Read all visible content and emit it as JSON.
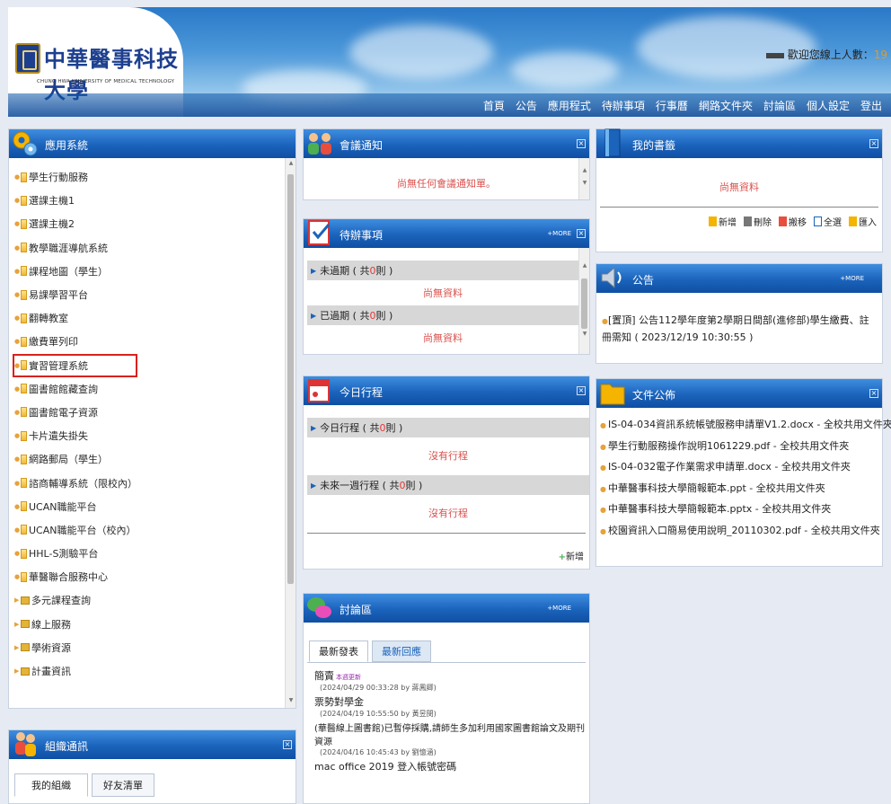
{
  "header": {
    "school_name": "中華醫事科技大學",
    "school_name_en": "CHUNG HWA UNIVERSITY OF MEDICAL TECHNOLOGY",
    "online_label": "歡迎您線上人數：",
    "online_count": "19",
    "nav": [
      "首頁",
      "公告",
      "應用程式",
      "待辦事項",
      "行事曆",
      "網路文件夾",
      "討論區",
      "個人設定",
      "登出"
    ]
  },
  "apps": {
    "title": "應用系統",
    "items": [
      {
        "label": "學生行動服務",
        "kind": "file"
      },
      {
        "label": "選課主機1",
        "kind": "file"
      },
      {
        "label": "選課主機2",
        "kind": "file"
      },
      {
        "label": "教學職涯導航系統",
        "kind": "file"
      },
      {
        "label": "課程地圖（學生）",
        "kind": "file"
      },
      {
        "label": "易課學習平台",
        "kind": "file"
      },
      {
        "label": "翻轉教室",
        "kind": "file"
      },
      {
        "label": "繳費單列印",
        "kind": "file"
      },
      {
        "label": "實習管理系統",
        "kind": "file",
        "selected": true
      },
      {
        "label": "圖書館館藏查詢",
        "kind": "file"
      },
      {
        "label": "圖書館電子資源",
        "kind": "file"
      },
      {
        "label": "卡片遺失掛失",
        "kind": "file"
      },
      {
        "label": "網路郵局（學生）",
        "kind": "file"
      },
      {
        "label": "諮商輔導系統（限校內）",
        "kind": "file"
      },
      {
        "label": "UCAN職能平台",
        "kind": "file"
      },
      {
        "label": "UCAN職能平台（校內）",
        "kind": "file"
      },
      {
        "label": "HHL-S測驗平台",
        "kind": "file"
      },
      {
        "label": "華醫聯合服務中心",
        "kind": "file"
      },
      {
        "label": "多元課程查詢",
        "kind": "folder"
      },
      {
        "label": "線上服務",
        "kind": "folder"
      },
      {
        "label": "學術資源",
        "kind": "folder"
      },
      {
        "label": "計畫資訊",
        "kind": "folder"
      }
    ]
  },
  "groups": {
    "title": "組織通訊",
    "tabs": [
      "我的組織",
      "好友清單"
    ]
  },
  "meeting": {
    "title": "會議通知",
    "empty": "尚無任何會議通知單。"
  },
  "todo": {
    "title": "待辦事項",
    "more": "+MORE",
    "sections": [
      {
        "prefix": "未過期 ( 共 ",
        "count": "0",
        "suffix": " 則 )",
        "empty": "尚無資料"
      },
      {
        "prefix": "已過期 ( 共 ",
        "count": "0",
        "suffix": " 則 )",
        "empty": "尚無資料"
      }
    ]
  },
  "today": {
    "title": "今日行程",
    "sections": [
      {
        "prefix": "今日行程 ( 共 ",
        "count": "0",
        "suffix": " 則 )",
        "empty": "沒有行程"
      },
      {
        "prefix": "未來一週行程 ( 共 ",
        "count": "0",
        "suffix": " 則 )",
        "empty": "沒有行程"
      }
    ],
    "add": "新增"
  },
  "forum": {
    "title": "討論區",
    "more": "+MORE",
    "tabs": [
      "最新發表",
      "最新回應"
    ],
    "posts": [
      {
        "title": "簡賣",
        "badge": "本週更新",
        "meta": "(2024/04/29 00:33:28 by 蔣鳳卿)"
      },
      {
        "title": "票勢對學金",
        "badge": "",
        "meta": "(2024/04/19 10:55:50 by 黃昱閔)"
      },
      {
        "title": "(華醫線上圖書館)已暫停採購,請師生多加利用國家圖書館論文及期刊資源",
        "badge": "",
        "meta": "(2024/04/16 10:45:43 by 劉憶涵)"
      },
      {
        "title": "mac office 2019 登入帳號密碼",
        "badge": "",
        "meta": ""
      }
    ]
  },
  "books": {
    "title": "我的書籤",
    "empty": "尚無資料",
    "actions": [
      "新增",
      "刪除",
      "搬移",
      "全選",
      "匯入"
    ]
  },
  "news": {
    "title": "公告",
    "more": "+MORE",
    "items": [
      "[置頂] 公告112學年度第2學期日間部(進修部)學生繳費、註冊需知 ( 2023/12/19 10:30:55 )"
    ]
  },
  "docs": {
    "title": "文件公佈",
    "items": [
      "IS-04-034資訊系統帳號服務申請單V1.2.docx - 全校共用文件夾",
      "學生行動服務操作說明1061229.pdf - 全校共用文件夾",
      "IS-04-032電子作業需求申請單.docx - 全校共用文件夾",
      "中華醫事科技大學簡報範本.ppt - 全校共用文件夾",
      "中華醫事科技大學簡報範本.pptx - 全校共用文件夾",
      "校園資訊入口簡易使用說明_20110302.pdf - 全校共用文件夾"
    ]
  },
  "colors": {
    "header_blue": "#1b63bb",
    "accent_orange": "#e6a23c",
    "alert_red": "#e53935",
    "select_border": "#d9221b"
  }
}
